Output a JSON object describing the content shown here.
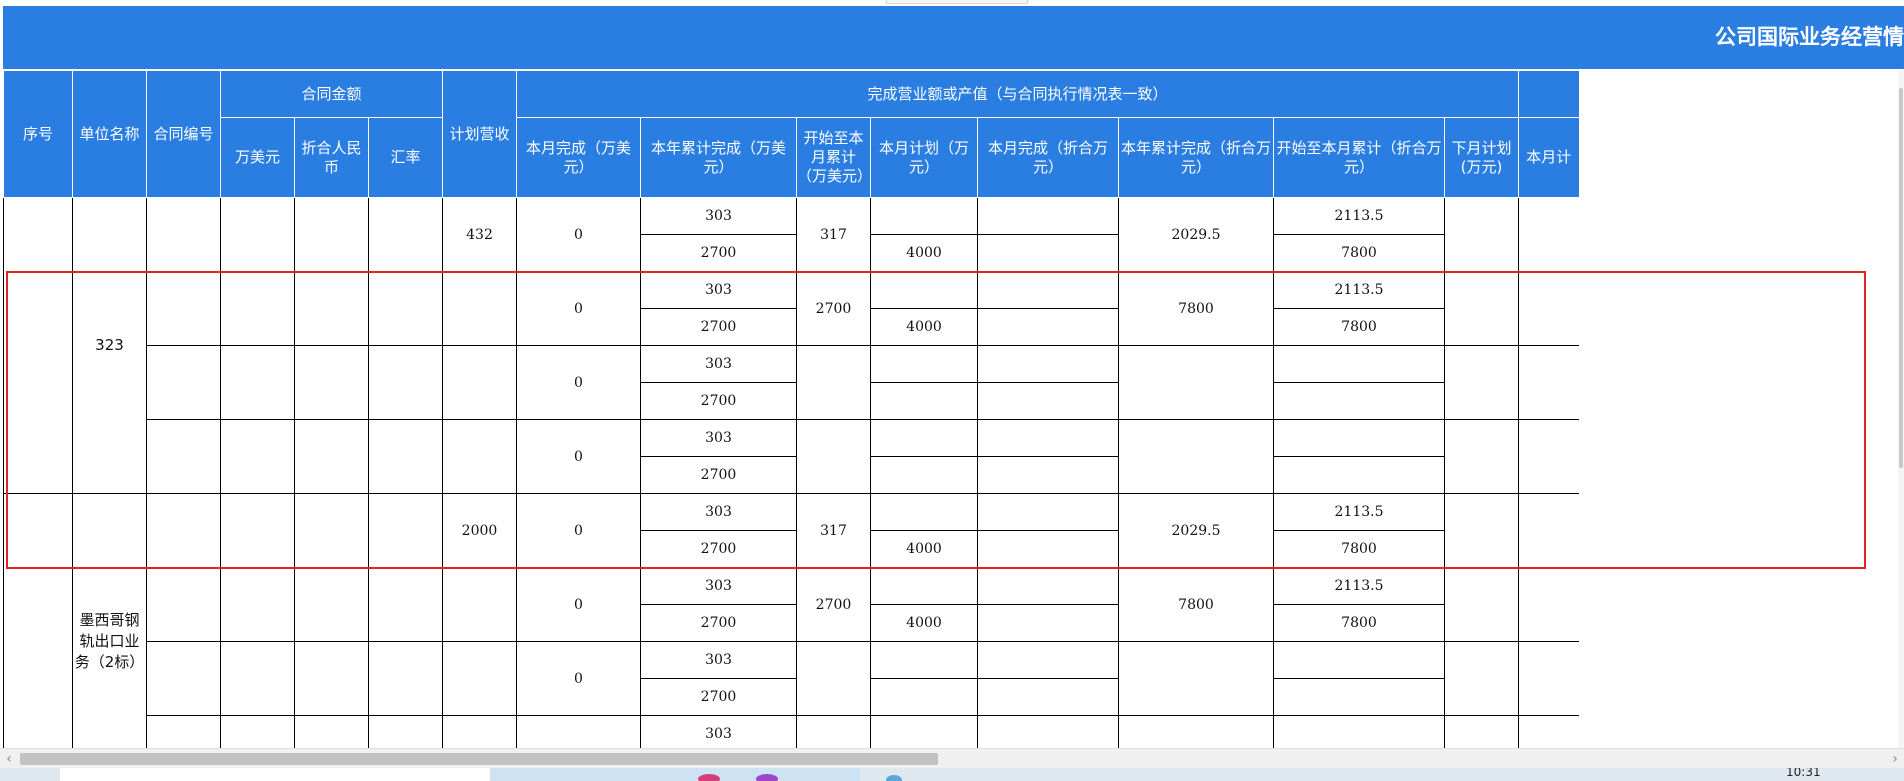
{
  "title": "公司国际业务经营情",
  "header": {
    "seq": "序号",
    "unit": "单位名称",
    "contract_no": "合同编号",
    "contract_amount": "合同金额",
    "usd": "万美元",
    "rmb": "折合人民币",
    "rate": "汇率",
    "plan_rev": "计划营收",
    "completion": "完成营业额或产值（与合同执行情况表一致）",
    "cols": {
      "month_usd": "本月完成（万美元）",
      "year_usd": "本年累计完成（万美元）",
      "total_usd": "开始至本月累计（万美元）",
      "plan": "本月计划（万元）",
      "month_cny": "本月完成（折合万元）",
      "year_cny": "本年累计完成（折合万元）",
      "total_cny": "开始至本月累计（折合万元）",
      "next_plan": "下月计划(万元)",
      "cut": "本月计"
    }
  },
  "groups": [
    {
      "unit_name": "323",
      "subgroups": [
        {
          "plan_rev": "432",
          "month_usd": "0",
          "year_usd": [
            "303",
            "2700"
          ],
          "total_usd": "317",
          "plan": [
            "",
            "4000"
          ],
          "year_cny": "2029.5",
          "total_cny": [
            "2113.5",
            "7800"
          ]
        },
        {
          "plan_rev": "",
          "month_usd": "0",
          "year_usd": [
            "303",
            "2700"
          ],
          "total_usd": "2700",
          "plan": [
            "",
            "4000"
          ],
          "year_cny": "7800",
          "total_cny": [
            "2113.5",
            "7800"
          ]
        },
        {
          "plan_rev": "",
          "month_usd": "0",
          "year_usd": [
            "303",
            "2700"
          ],
          "total_usd": "",
          "plan": [
            "",
            ""
          ],
          "year_cny": "",
          "total_cny": [
            "",
            ""
          ]
        },
        {
          "plan_rev": "",
          "month_usd": "0",
          "year_usd": [
            "303",
            "2700"
          ],
          "total_usd": "",
          "plan": [
            "",
            ""
          ],
          "year_cny": "",
          "total_cny": [
            "",
            ""
          ]
        }
      ]
    },
    {
      "unit_name": "墨西哥钢轨出口业务（2标）",
      "subgroups": [
        {
          "plan_rev": "2000",
          "month_usd": "0",
          "year_usd": [
            "303",
            "2700"
          ],
          "total_usd": "317",
          "plan": [
            "",
            "4000"
          ],
          "year_cny": "2029.5",
          "total_cny": [
            "2113.5",
            "7800"
          ]
        },
        {
          "plan_rev": "",
          "month_usd": "0",
          "year_usd": [
            "303",
            "2700"
          ],
          "total_usd": "2700",
          "plan": [
            "",
            "4000"
          ],
          "year_cny": "7800",
          "total_cny": [
            "2113.5",
            "7800"
          ]
        },
        {
          "plan_rev": "",
          "month_usd": "0",
          "year_usd": [
            "303",
            "2700"
          ],
          "total_usd": "",
          "plan": [
            "",
            ""
          ],
          "year_cny": "",
          "total_cny": [
            "",
            ""
          ]
        },
        {
          "plan_rev": "",
          "month_usd": "",
          "year_usd": [
            "303",
            ""
          ],
          "total_usd": "",
          "plan": [
            "",
            ""
          ],
          "year_cny": "",
          "total_cny": [
            "",
            ""
          ]
        }
      ]
    }
  ],
  "taskbar": {
    "clock": "10:31"
  },
  "scroll": {
    "left_arrow": "‹",
    "right_arrow": "›"
  },
  "colors": {
    "header_bg": "#2a7de1",
    "header_text": "#ffffff",
    "highlight": "#e32323"
  }
}
